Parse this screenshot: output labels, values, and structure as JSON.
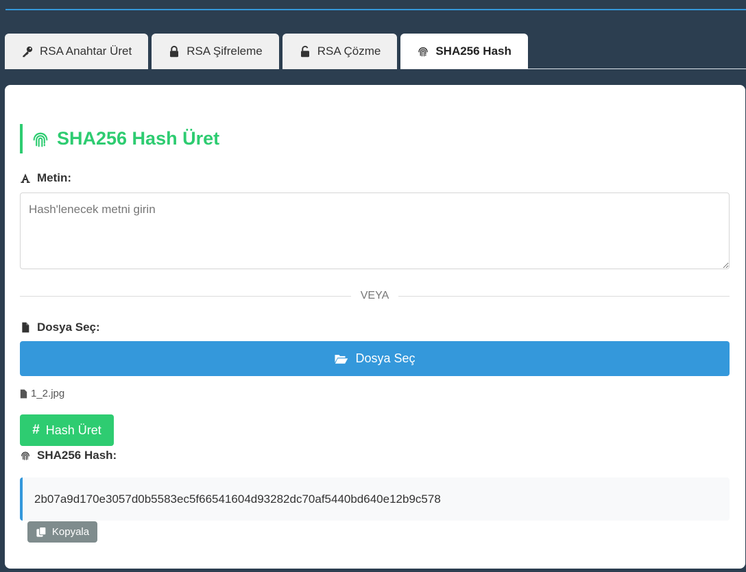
{
  "tabs": [
    {
      "label": "RSA Anahtar Üret",
      "icon": "key-icon",
      "active": false
    },
    {
      "label": "RSA Şifreleme",
      "icon": "lock-icon",
      "active": false
    },
    {
      "label": "RSA Çözme",
      "icon": "unlock-icon",
      "active": false
    },
    {
      "label": "SHA256 Hash",
      "icon": "fingerprint-icon",
      "active": true
    }
  ],
  "section": {
    "title": "SHA256 Hash Üret",
    "title_icon": "fingerprint-icon"
  },
  "text_input": {
    "label": "Metin:",
    "label_icon": "font-icon",
    "placeholder": "Hash'lenecek metni girin",
    "value": ""
  },
  "divider_text": "VEYA",
  "file_input": {
    "label": "Dosya Seç:",
    "label_icon": "file-icon",
    "button_label": "Dosya Seç",
    "button_icon": "folder-open-icon",
    "selected_file": "1_2.jpg"
  },
  "hash_button": {
    "label": "Hash Üret",
    "icon": "hashtag-icon"
  },
  "result": {
    "label": "SHA256 Hash:",
    "label_icon": "fingerprint-icon",
    "value": "2b07a9d170e3057d0b5583ec5f66541604d93282dc70af5440bd640e12b9c578"
  },
  "copy_button": {
    "label": "Kopyala",
    "icon": "copy-icon"
  },
  "colors": {
    "background": "#2c3e50",
    "accent_blue": "#3498db",
    "accent_green": "#2ecc71",
    "copy_gray": "#7f8c8d",
    "result_bg": "#f8f9fa"
  }
}
